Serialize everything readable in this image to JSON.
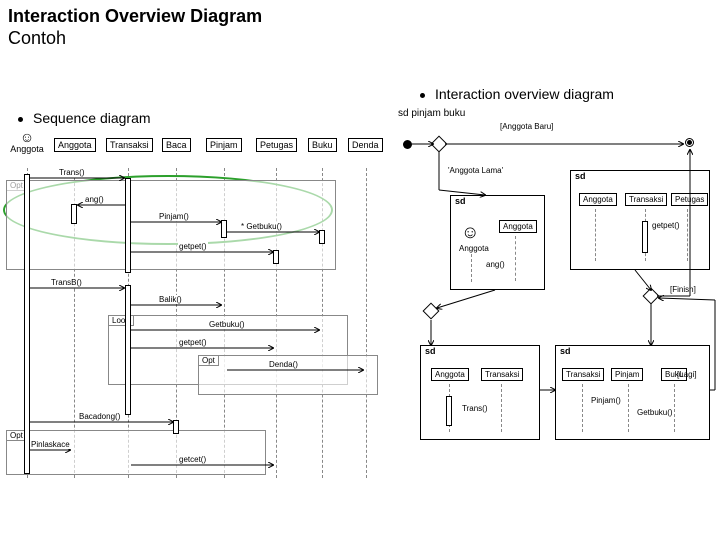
{
  "title": "Interaction Overview Diagram",
  "subtitle": "Contoh",
  "bullets": {
    "left": "Sequence diagram",
    "right": "Interaction overview diagram"
  },
  "sequence": {
    "lifelines": [
      {
        "name": "Anggota",
        "type": "actor"
      },
      {
        "name": "Anggota",
        "type": "class"
      },
      {
        "name": "Transaksi",
        "type": "class"
      },
      {
        "name": "Baca",
        "type": "class"
      },
      {
        "name": "Pinjam",
        "type": "class"
      },
      {
        "name": "Petugas",
        "type": "class"
      },
      {
        "name": "Buku",
        "type": "class"
      },
      {
        "name": "Denda",
        "type": "class"
      }
    ],
    "fragments": [
      "Opt",
      "Loop",
      "Opt",
      "Opt"
    ],
    "messages": {
      "m1": "Trans()",
      "m2": "ang()",
      "m3": "Pinjam()",
      "m4": "* Getbuku()",
      "m5": "getpet()",
      "m6": "TransB()",
      "m7": "Balik()",
      "m8": "Getbuku()",
      "m9": "getpet()",
      "m10": "Denda()",
      "m11": "Bacadong()",
      "m12": "Pinlaskace",
      "m13": "getcet()"
    }
  },
  "overview": {
    "frame_title": "sd pinjam buku",
    "guards": {
      "g1": "[Anggota Baru]",
      "g2": "'Anggota Lama'",
      "g3": "[Finish]",
      "g4": "[Lagi]"
    },
    "sd_frames": {
      "a": {
        "tag": "sd",
        "lifelines": [
          "Anggota"
        ],
        "actor": "Anggota",
        "msg": "ang()"
      },
      "b": {
        "tag": "sd",
        "lifelines": [
          "Anggota",
          "Transaksi",
          "Petugas"
        ],
        "msg": "getpet()"
      },
      "c": {
        "tag": "sd",
        "lifelines": [
          "Anggota",
          "Transaksi"
        ],
        "msg": "Trans()"
      },
      "d": {
        "tag": "sd",
        "lifelines": [
          "Transaksi",
          "Pinjam",
          "Buku"
        ],
        "msg1": "Pinjam()",
        "msg2": "Getbuku()"
      }
    }
  }
}
